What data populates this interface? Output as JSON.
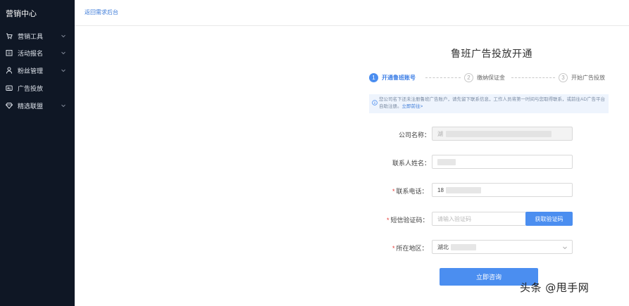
{
  "sidebar": {
    "brand": "营销中心",
    "items": [
      {
        "label": "营销工具",
        "icon": "cart-icon",
        "has_submenu": true
      },
      {
        "label": "活动报名",
        "icon": "calendar-icon",
        "has_submenu": true
      },
      {
        "label": "粉丝管理",
        "icon": "user-icon",
        "has_submenu": true
      },
      {
        "label": "广告投放",
        "icon": "ad-icon",
        "has_submenu": false
      },
      {
        "label": "精选联盟",
        "icon": "diamond-icon",
        "has_submenu": true
      }
    ]
  },
  "topbar": {
    "back_label": "返回需求后台"
  },
  "page": {
    "title": "鲁班广告投放开通"
  },
  "steps": [
    {
      "number": "1",
      "label": "开通鲁班账号",
      "active": true
    },
    {
      "number": "2",
      "label": "缴纳保证金",
      "active": false
    },
    {
      "number": "3",
      "label": "开始广告投放",
      "active": false
    }
  ],
  "notice": {
    "text": "您公司名下还未注册鲁班广告账户，请先留下联系信息，工作人员将第一时间与您取得联系，或前往AD广告平台自助注册。",
    "link": "立即前往>"
  },
  "form": {
    "company_label": "公司名称",
    "company_value": "湖",
    "contact_label": "联系人姓名",
    "phone_label": "联系电话",
    "phone_value": "18",
    "code_label": "短信验证码",
    "code_placeholder": "请输入验证码",
    "code_button": "获取验证码",
    "region_label": "所在地区",
    "region_value": "湖北",
    "colon": "：",
    "submit": "立即咨询"
  },
  "watermark": "头条 @甩手网",
  "colors": {
    "sidebar_bg": "#0f1725",
    "accent": "#4b8ef0",
    "required": "#e53935"
  }
}
